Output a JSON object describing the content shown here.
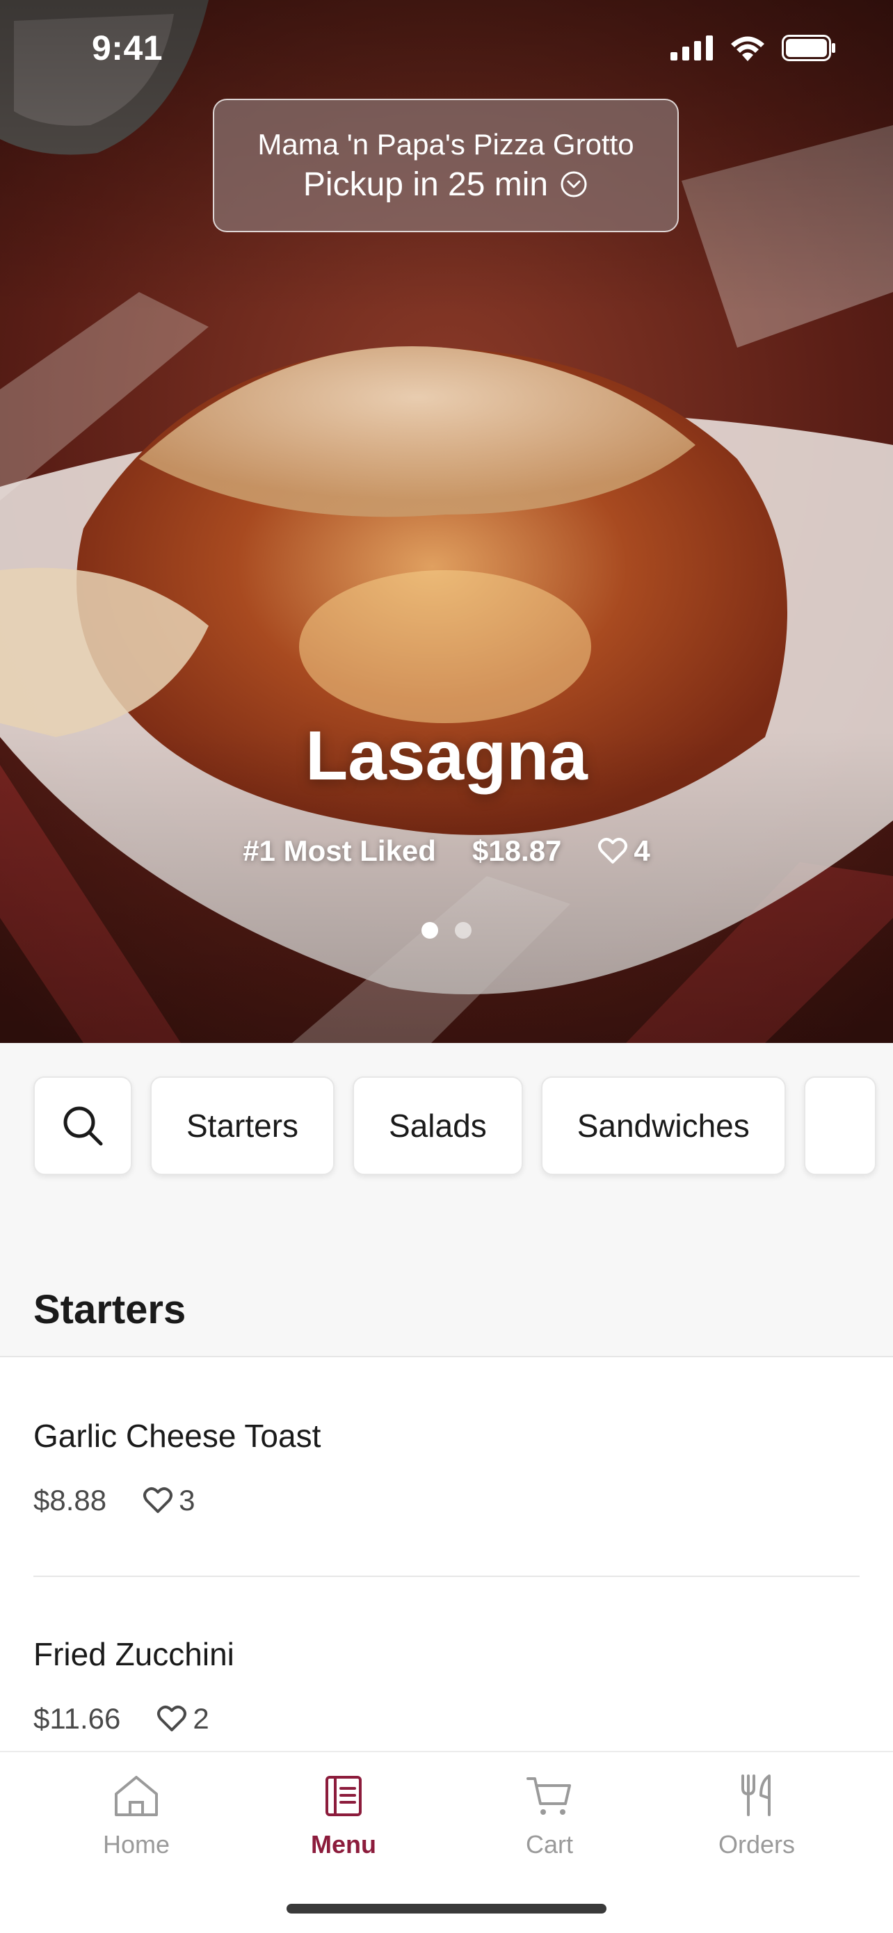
{
  "status": {
    "time": "9:41"
  },
  "store": {
    "name": "Mama 'n Papa's Pizza Grotto",
    "pickup": "Pickup in 25 min"
  },
  "featured": {
    "title": "Lasagna",
    "badge": "#1 Most Liked",
    "price": "$18.87",
    "likes": "4",
    "page_count": 2,
    "active_page": 1
  },
  "categories": [
    "Starters",
    "Salads",
    "Sandwiches"
  ],
  "section": {
    "title": "Starters",
    "items": [
      {
        "name": "Garlic Cheese Toast",
        "price": "$8.88",
        "likes": "3"
      },
      {
        "name": "Fried Zucchini",
        "price": "$11.66",
        "likes": "2"
      }
    ]
  },
  "tabs": [
    {
      "label": "Home",
      "icon": "home-icon"
    },
    {
      "label": "Menu",
      "icon": "menu-icon",
      "active": true
    },
    {
      "label": "Cart",
      "icon": "cart-icon"
    },
    {
      "label": "Orders",
      "icon": "fork-knife-icon"
    }
  ],
  "colors": {
    "accent": "#8c1c3c",
    "inactive": "#9a9a9a",
    "background": "#f7f7f7"
  }
}
